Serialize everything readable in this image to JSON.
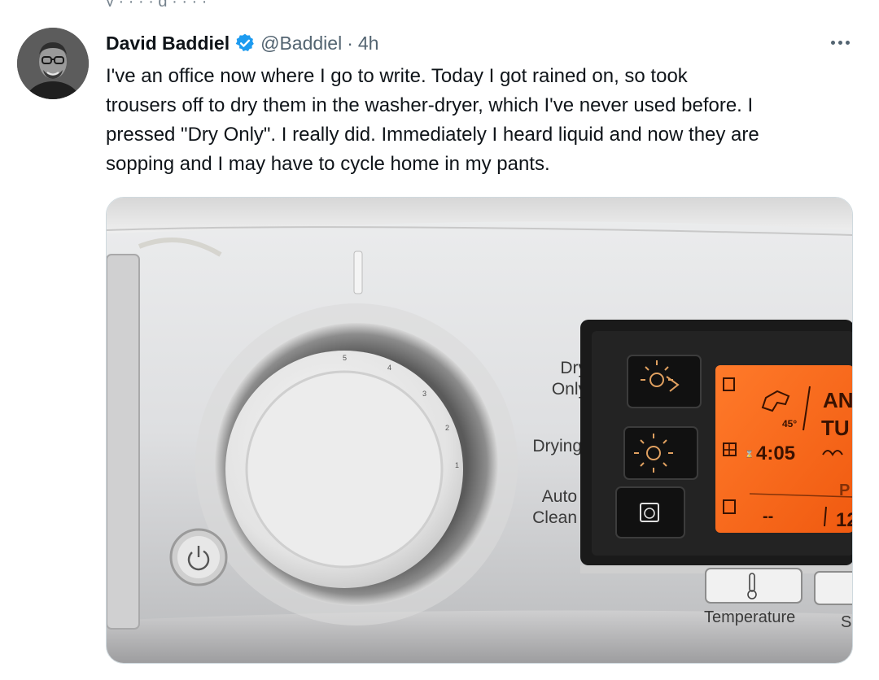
{
  "tweet": {
    "author_name": "David Baddiel",
    "handle": "@Baddiel",
    "separator": "·",
    "time": "4h",
    "text_lines": [
      "I've an office now where I go to write. Today I got rained on, so took",
      "trousers off to dry them in the washer-dryer, which I've never used before. I",
      "pressed \"Dry Only\". I really did. Immediately I heard liquid and now they are",
      "sopping and I may have to cycle home in my pants."
    ]
  },
  "icons": {
    "avatar": "avatar-photo",
    "verified": "verified-badge-icon",
    "more": "more-options-icon"
  },
  "colors": {
    "verified": "#1d9bf0",
    "secondary_text": "#536471",
    "lcd_orange": "#ff6a1a"
  },
  "media": {
    "panel_labels": {
      "dry_only_1": "Dry",
      "dry_only_2": "Only",
      "drying": "Drying",
      "auto_clean_1": "Auto",
      "auto_clean_2": "Clean",
      "temperature": "Temperature",
      "cut_label": "S"
    },
    "display": {
      "temp_badge": "45°",
      "time": "4:05",
      "dashes": "--",
      "text_right_1": "AN",
      "text_right_2": "TU",
      "text_right_3": "P",
      "text_right_4": "12"
    },
    "dial_ticks": [
      "5",
      "4",
      "3",
      "2",
      "1"
    ]
  }
}
